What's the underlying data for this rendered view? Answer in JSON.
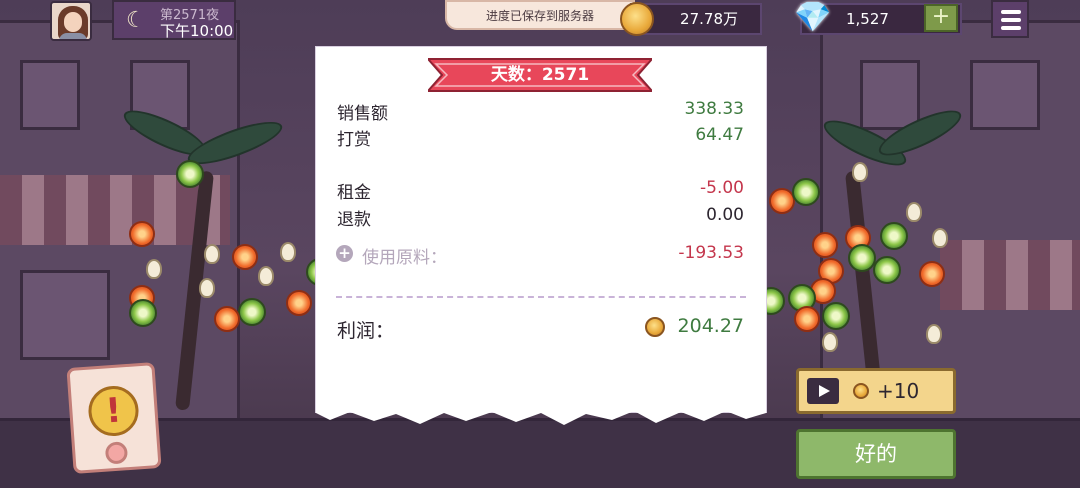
{
  "hud": {
    "night_label": "第2571夜",
    "time": "下午10:00",
    "save_toast": "进度已保存到服务器",
    "coins": "27.78万",
    "gems": "1,527",
    "plus": "+"
  },
  "receipt": {
    "day_banner": "天数：2571",
    "rows": [
      {
        "label": "销售额",
        "value": "338.33"
      },
      {
        "label": "打赏",
        "value": "64.47"
      },
      {
        "label": "租金",
        "value": "-5.00"
      },
      {
        "label": "退款",
        "value": "0.00"
      },
      {
        "label": "使用原料：",
        "value": "-193.53"
      }
    ],
    "profit_label": "利润：",
    "profit_value": "204.27"
  },
  "buttons": {
    "ad_reward": "+10",
    "ok": "好的",
    "alert": "!"
  },
  "colors": {
    "positive": "#3f7b40",
    "negative": "#c4364c",
    "ok_button": "#8eb86a",
    "ad_button": "#f3d58c"
  }
}
